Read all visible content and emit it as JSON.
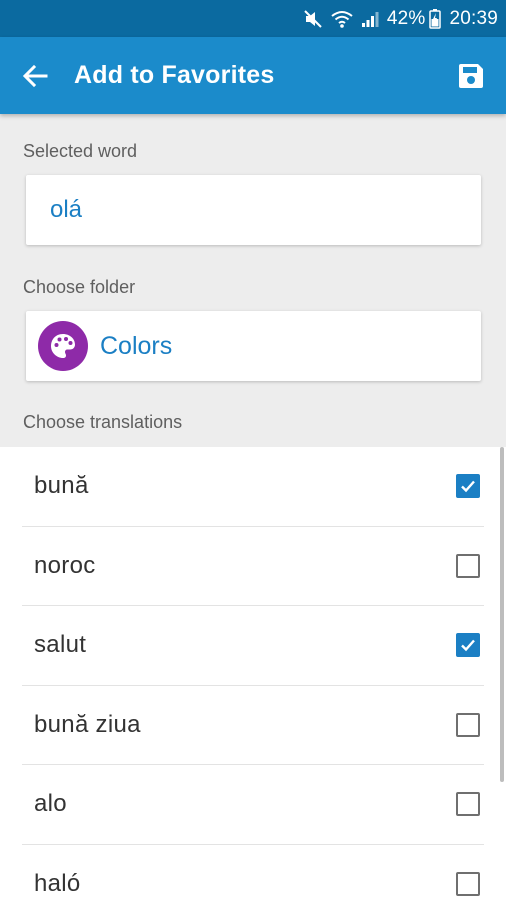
{
  "status_bar": {
    "battery": "42%",
    "time": "20:39",
    "icons": [
      "mute-icon",
      "wifi-icon",
      "signal-icon",
      "battery-icon"
    ]
  },
  "app_bar": {
    "title": "Add to Favorites",
    "back_icon": "arrow-back-icon",
    "save_icon": "save-icon"
  },
  "form": {
    "selected_word_label": "Selected word",
    "selected_word": "olá",
    "choose_folder_label": "Choose folder",
    "folder_name": "Colors",
    "folder_icon": "palette-icon",
    "choose_translations_label": "Choose translations"
  },
  "translations": [
    {
      "label": "bună",
      "checked": true
    },
    {
      "label": "noroc",
      "checked": false
    },
    {
      "label": "salut",
      "checked": true
    },
    {
      "label": "bună ziua",
      "checked": false
    },
    {
      "label": "alo",
      "checked": false
    },
    {
      "label": "haló",
      "checked": false
    }
  ],
  "colors": {
    "status_bar": "#0b6aa0",
    "app_bar": "#1b8bcb",
    "accent": "#1b7fc4",
    "folder_icon_bg": "#8e2aa8",
    "form_background": "#ededed"
  }
}
